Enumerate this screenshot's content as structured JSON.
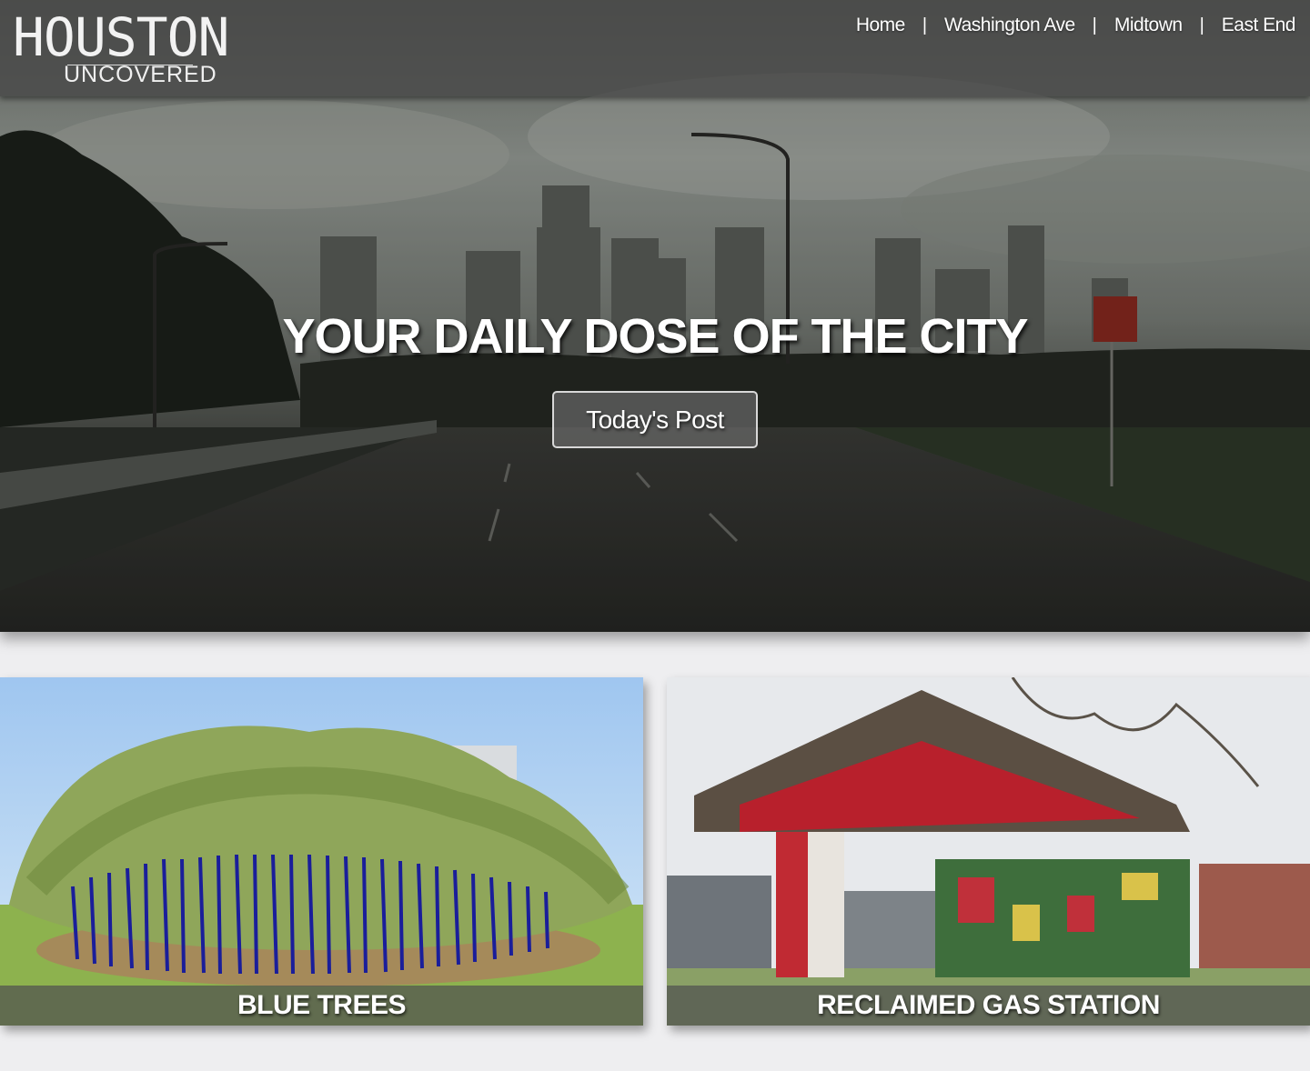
{
  "header": {
    "logo_main": "HOUSTON",
    "logo_sub": "UNCOVERED",
    "nav": [
      {
        "label": "Home"
      },
      {
        "label": "Washington Ave"
      },
      {
        "label": "Midtown"
      },
      {
        "label": "East End"
      }
    ],
    "nav_separator": "|"
  },
  "hero": {
    "tagline": "YOUR DAILY DOSE OF THE CITY",
    "cta_label": "Today's Post"
  },
  "cards": [
    {
      "caption": "BLUE TREES"
    },
    {
      "caption": "RECLAIMED GAS STATION"
    }
  ],
  "colors": {
    "header_bg": "#464646",
    "page_bg": "#eeeef0",
    "text": "#ffffff",
    "blue_trees": "#1a1e9a",
    "station_red": "#b8202c"
  }
}
